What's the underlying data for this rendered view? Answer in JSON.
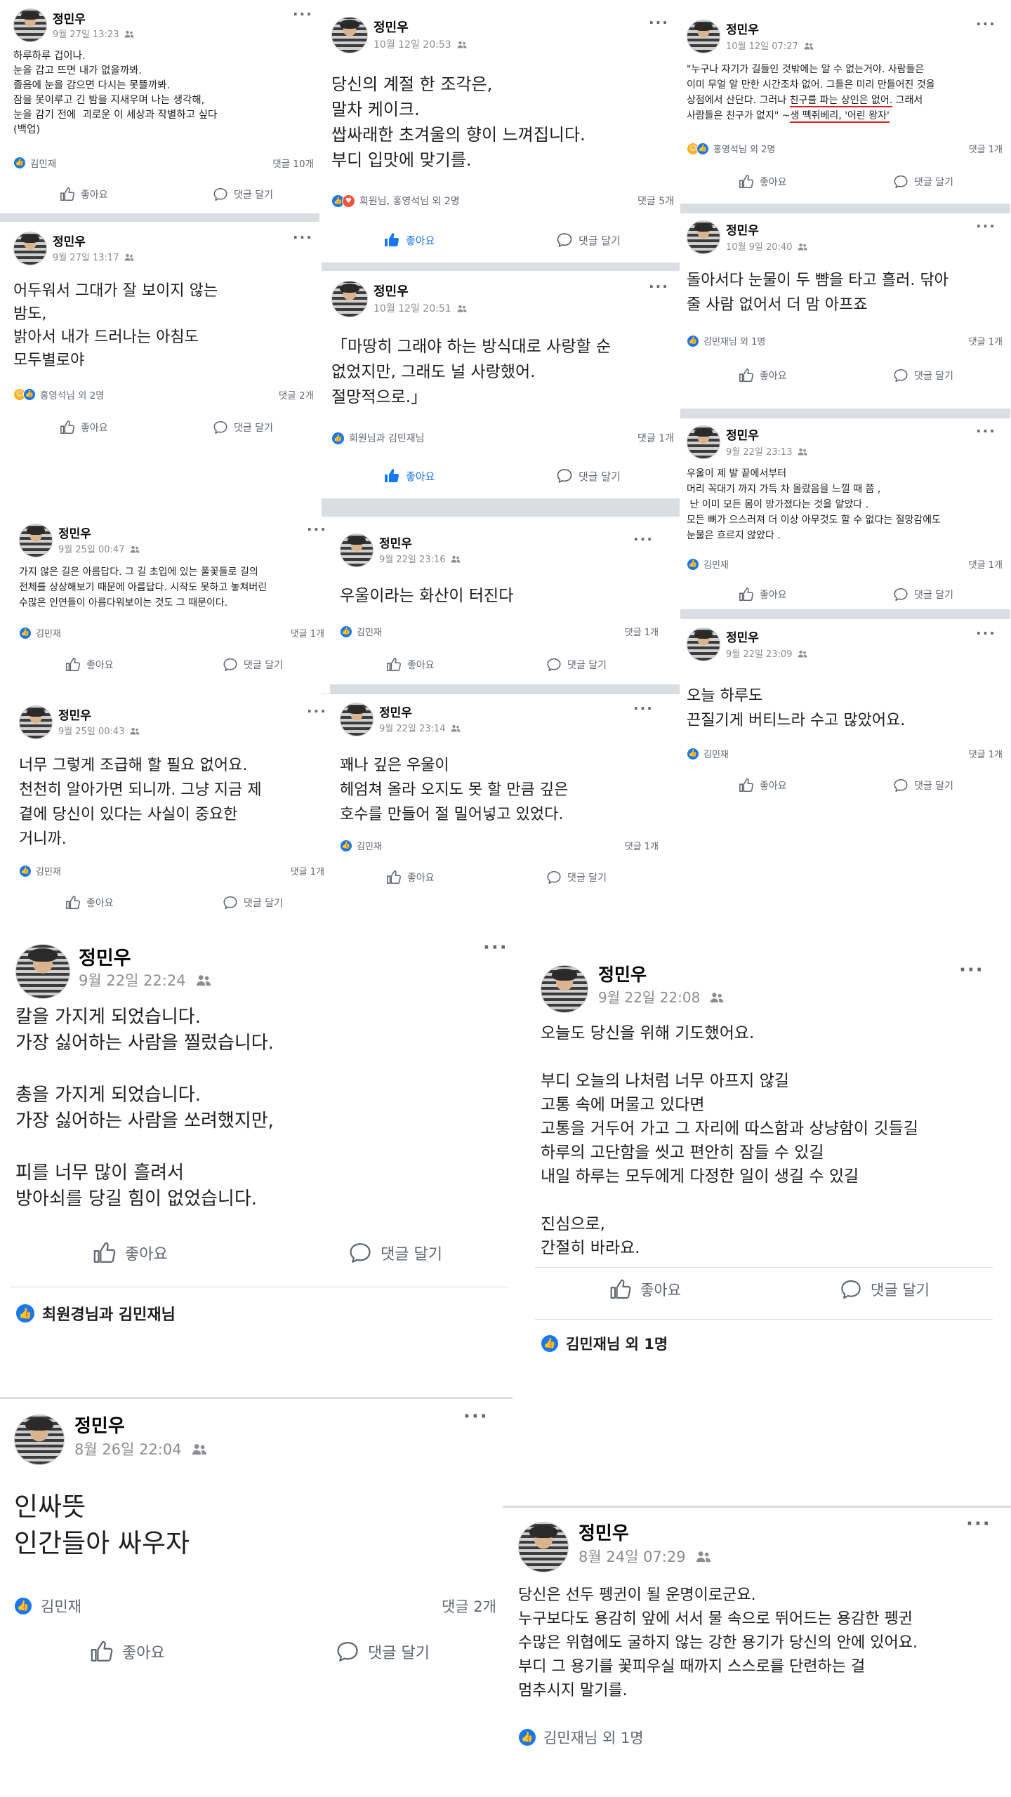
{
  "author": "정민우",
  "labels": {
    "like": "좋아요",
    "comment": "댓글 달기"
  },
  "colors": {
    "like_blue": "#1877f2",
    "text": "#1c1e21",
    "meta_gray": "#8a8d91",
    "underline": "#e02020"
  },
  "posts": [
    {
      "id": "p1",
      "date": "9월 27일 13:23",
      "body": "하루하루 겁이나.\n눈을 감고 뜨면 내가 없을까봐.\n졸음에 눈을 감으면 다시는 못뜰까봐.\n잠을 못이루고 긴 밤을 지새우며 나는 생각해,\n눈을 감기 전에  괴로운 이 세상과 작별하고 싶다\n(백업)",
      "reactors": "김민재",
      "comments": "댓글 10개"
    },
    {
      "id": "p2",
      "date": "10월 12일 20:53",
      "body": "당신의 계절 한 조각은,\n말차 케이크.\n쌉싸래한 초겨울의 향이 느껴집니다.\n부디 입맛에 맞기를.",
      "reactors": "회원님, 홍영석님 외 2명",
      "comments": "댓글 5개"
    },
    {
      "id": "p3",
      "date": "10월 12일 07:27",
      "body_a": "\"누구나 자기가 길들인 것밖에는 알 수 없는거야. 사람들은\n이미 무얼 알 만한 시간조차 없어. 그들은 미리 만들어진 것을\n상점에서 산단다. 그러나 ",
      "body_u1": "친구를 파는 상인은 없어.",
      "body_b": " 그래서\n사람들은 친구가 없지\" ~",
      "body_u2": "생 떽쥐베리, '어린 왕자'",
      "reactors": "홍영석님 외 2명",
      "comments": "댓글 1개"
    },
    {
      "id": "p4",
      "date": "9월 27일 13:17",
      "body": "어두워서 그대가 잘 보이지 않는\n밤도,\n밝아서 내가 드러나는 아침도\n모두별로야",
      "reactors": "홍영석님 외 2명",
      "comments": "댓글 2개"
    },
    {
      "id": "p5",
      "date": "10월 9일 20:40",
      "body": "돌아서다 눈물이 두 뺨을 타고 흘러. 닦아\n줄 사람 없어서 더 맘 아프죠",
      "reactors": "김민재님 외 1명",
      "comments": "댓글 1개"
    },
    {
      "id": "p6",
      "date": "10월 12일 20:51",
      "body": "「마땅히 그래야 하는 방식대로 사랑할 순\n없었지만, 그래도 널 사랑했어.\n절망적으로.」",
      "reactors": "회원님과 김민재님",
      "comments": "댓글 1개"
    },
    {
      "id": "p7",
      "date": "9월 22일 23:13",
      "body": "우울이 제 발 끝에서부터\n머리 꼭대기 까지 가득 차 올랐음을 느낄 때 쯤 ,\n 난 이미 모든 몸이 망가졌다는 것을 알았다 .\n모든 뼈가 으스러져 더 이상 아무것도 할 수 없다는 절망감에도\n눈물은 흐르지 않았다 .",
      "reactors": "김민재",
      "comments": "댓글 1개"
    },
    {
      "id": "p8",
      "date": "9월 25일 00:47",
      "body": "가지 않은 길은 아름답다. 그 길 초입에 있는 풀꽃들로 길의\n전체를 상상해보기 때문에 아름답다. 시작도 못하고 놓쳐버린\n수많은 인연들이 아름다워보이는 것도 그 때문이다.",
      "reactors": "김민재",
      "comments": "댓글 1개"
    },
    {
      "id": "p9",
      "date": "9월 22일 23:16",
      "body": "우울이라는 화산이 터진다",
      "reactors": "김민재",
      "comments": "댓글 1개"
    },
    {
      "id": "p10",
      "date": "9월 22일 23:09",
      "body": "오늘 하루도\n끈질기게 버티느라 수고 많았어요.",
      "reactors": "김민재",
      "comments": "댓글 1개"
    },
    {
      "id": "p11",
      "date": "9월 25일 00:43",
      "body": "너무 그렇게 조급해 할 필요 없어요.\n천천히 알아가면 되니까. 그냥 지금 제\n곁에 당신이 있다는 사실이 중요한\n거니까.",
      "reactors": "김민재",
      "comments": "댓글 1개"
    },
    {
      "id": "p12",
      "date": "9월 22일 23:14",
      "body": "꽤나 깊은 우울이\n헤엄쳐 올라 오지도 못 할 만큼 깊은\n호수를 만들어 절 밀어넣고 있었다.",
      "reactors": "김민재",
      "comments": "댓글 1개"
    },
    {
      "id": "p13",
      "date": "9월 22일 22:24",
      "body": "칼을 가지게 되었습니다.\n가장 싫어하는 사람을 찔렀습니다.\n\n총을 가지게 되었습니다.\n가장 싫어하는 사람을 쏘려했지만,\n\n피를 너무 많이 흘려서\n방아쇠를 당길 힘이 없었습니다.",
      "reactors": "최원경님과 김민재님",
      "comments": ""
    },
    {
      "id": "p14",
      "date": "9월 22일 22:08",
      "body": "오늘도 당신을 위해 기도했어요.\n\n부디 오늘의 나처럼 너무 아프지 않길\n고통 속에 머물고 있다면\n고통을 거두어 가고 그 자리에 따스함과 상냥함이 깃들길\n하루의 고단함을 씻고 편안히 잠들 수 있길\n내일 하루는 모두에게 다정한 일이 생길 수 있길\n\n진심으로,\n간절히 바라요.",
      "reactors": "김민재님 외 1명",
      "comments": ""
    },
    {
      "id": "p15",
      "date": "8월 26일 22:04",
      "body": "인싸뜻\n인간들아 싸우자",
      "reactors": "김민재",
      "comments": "댓글 2개"
    },
    {
      "id": "p16",
      "date": "8월 24일 07:29",
      "body": "당신은 선두 펭귄이 될 운명이로군요.\n누구보다도 용감히 앞에 서서 물 속으로 뛰어드는 용감한 펭귄\n수많은 위협에도 굴하지 않는 강한 용기가 당신의 안에 있어요.\n부디 그 용기를 꽃피우실 때까지 스스로를 단련하는 걸\n멈추시지 말기를.",
      "reactors": "김민재님 외 1명",
      "comments": ""
    }
  ]
}
